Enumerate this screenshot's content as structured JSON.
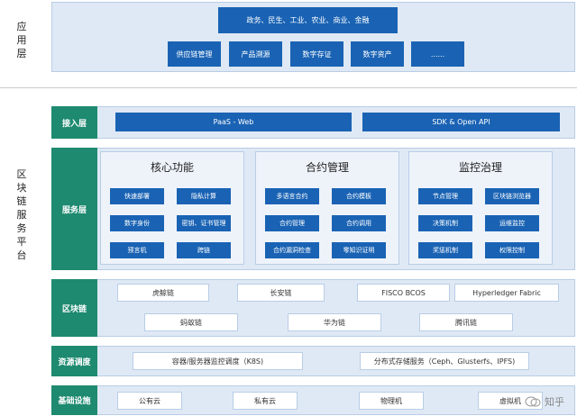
{
  "side_labels": {
    "app": "应用层",
    "platform": "区块链服务平台"
  },
  "app_layer": {
    "sectors": "政务、民生、工业、农业、商业、金融",
    "items": [
      "供应链管理",
      "产品溯源",
      "数字存证",
      "数字资产",
      "......"
    ]
  },
  "access_layer": {
    "label": "接入层",
    "items": [
      "PaaS - Web",
      "SDK & Open API"
    ]
  },
  "service_layer": {
    "label": "服务层",
    "groups": [
      {
        "title": "核心功能",
        "items": [
          "快速部署",
          "隐私计算",
          "数字身份",
          "密钥、证书管理",
          "预言机",
          "跨链"
        ]
      },
      {
        "title": "合约管理",
        "items": [
          "多语言合约",
          "合约模板",
          "合约管理",
          "合约调用",
          "合约漏洞检查",
          "零知识证明"
        ]
      },
      {
        "title": "监控治理",
        "items": [
          "节点管理",
          "区块链浏览器",
          "决策机制",
          "运维监控",
          "奖惩机制",
          "权限控制"
        ]
      }
    ]
  },
  "blockchain_layer": {
    "label": "区块链",
    "row1": [
      "虎鲸链",
      "长安链",
      "FISCO BCOS",
      "Hyperledger Fabric"
    ],
    "row2": [
      "蚂蚁链",
      "华为链",
      "腾讯链"
    ]
  },
  "resource_layer": {
    "label": "资源调度",
    "items": [
      "容器/服务器监控调度（K8S)",
      "分布式存储服务（Ceph、Glusterfs、IPFS)"
    ]
  },
  "infra_layer": {
    "label": "基础设施",
    "items": [
      "公有云",
      "私有云",
      "物理机",
      "虚拟机"
    ]
  },
  "watermark": "知乎"
}
